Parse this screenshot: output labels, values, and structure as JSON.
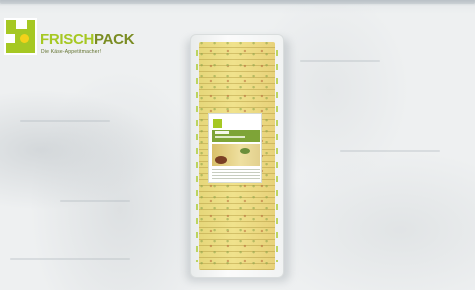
{
  "brand": {
    "name_part1": "FRISCH",
    "name_part2": "PACK",
    "tagline": "Die Käse-Appetitmacher!",
    "accent_color": "#a6c823",
    "accent_dark": "#7a8c23",
    "icon": "cheese-logo-icon"
  },
  "product": {
    "type": "sliced-cheese-package-photo"
  },
  "background": {
    "description_color": "#eef0f1"
  }
}
